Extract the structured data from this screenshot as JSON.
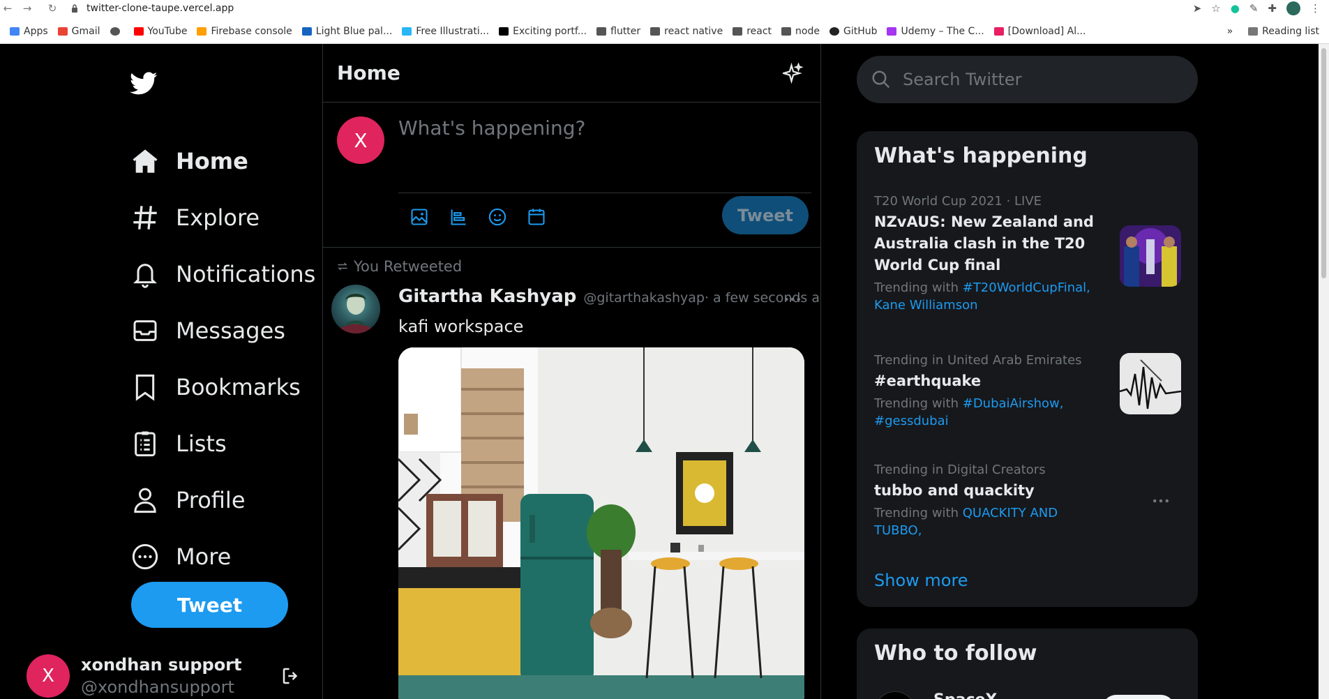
{
  "browser": {
    "url": "twitter-clone-taupe.vercel.app",
    "bookmarks": [
      {
        "label": "Apps",
        "color": "#4285f4"
      },
      {
        "label": "Gmail",
        "color": "#ea4335"
      },
      {
        "label": "",
        "color": "#555555"
      },
      {
        "label": "YouTube",
        "color": "#ff0000"
      },
      {
        "label": "Firebase console",
        "color": "#ffa000"
      },
      {
        "label": "Light Blue pal...",
        "color": "#1565c0"
      },
      {
        "label": "Free Illustrati...",
        "color": "#29b6f6"
      },
      {
        "label": "Exciting portf...",
        "color": "#000000"
      },
      {
        "label": "flutter",
        "color": "#555555"
      },
      {
        "label": "react native",
        "color": "#555555"
      },
      {
        "label": "react",
        "color": "#555555"
      },
      {
        "label": "node",
        "color": "#555555"
      },
      {
        "label": "GitHub",
        "color": "#222222"
      },
      {
        "label": "Udemy – The C...",
        "color": "#a435f0"
      },
      {
        "label": "[Download] Al...",
        "color": "#e91e63"
      }
    ],
    "more_bookmarks": "»",
    "reading_list": "Reading list"
  },
  "sidebar": {
    "items": [
      {
        "label": "Home",
        "icon": "home-icon"
      },
      {
        "label": "Explore",
        "icon": "hashtag-icon"
      },
      {
        "label": "Notifications",
        "icon": "bell-icon"
      },
      {
        "label": "Messages",
        "icon": "mail-icon"
      },
      {
        "label": "Bookmarks",
        "icon": "bookmark-icon"
      },
      {
        "label": "Lists",
        "icon": "list-icon"
      },
      {
        "label": "Profile",
        "icon": "person-icon"
      },
      {
        "label": "More",
        "icon": "more-circle-icon"
      }
    ],
    "tweet_label": "Tweet",
    "user": {
      "initial": "X",
      "name": "xondhan support",
      "handle": "@xondhansupport"
    }
  },
  "center": {
    "title": "Home",
    "composer": {
      "avatar_initial": "X",
      "placeholder": "What's happening?",
      "tweet_label": "Tweet"
    },
    "retweet_label": "You Retweeted",
    "post": {
      "name": "Gitartha Kashyap",
      "handle": "@gitarthakashyap",
      "dot": "·",
      "time": "a few seconds ago",
      "text": "kafi workspace"
    }
  },
  "right": {
    "search_placeholder": "Search Twitter",
    "happening_title": "What's happening",
    "trends": [
      {
        "meta": "T20 World Cup 2021 · LIVE",
        "title": "NZvAUS: New Zealand and Australia clash in the T20 World Cup final",
        "with": "Trending with ",
        "tags": "#T20WorldCupFinal, Kane Williamson"
      },
      {
        "meta": "Trending in United Arab Emirates",
        "title": "#earthquake",
        "with": "Trending with ",
        "tags": "#DubaiAirshow, #gessdubai"
      },
      {
        "meta": "Trending in Digital Creators",
        "title": "tubbo and quackity",
        "with": "Trending with ",
        "tags": "QUACKITY AND TUBBO,"
      }
    ],
    "show_more": "Show more",
    "follow_title": "Who to follow",
    "follow_name": "SpaceX"
  },
  "colors": {
    "accent": "#1d9bf0",
    "avatar": "#e0245e",
    "background": "#000000",
    "panel": "#16181c"
  }
}
